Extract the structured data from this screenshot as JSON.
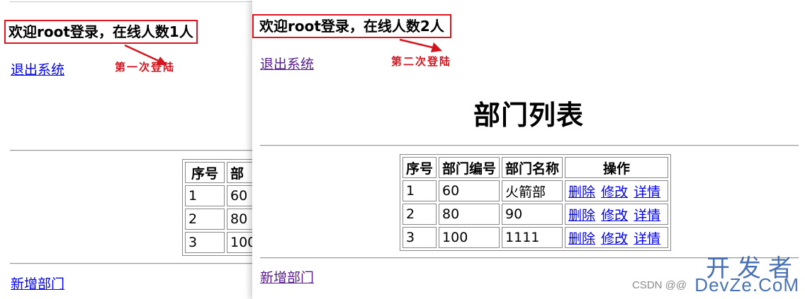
{
  "left_window": {
    "welcome": "欢迎root登录，在线人数1人",
    "logout_label": "退出系统",
    "annotation": "第一次登陆",
    "table": {
      "headers": [
        "序号",
        "部"
      ],
      "rows": [
        [
          "1",
          "60"
        ],
        [
          "2",
          "80"
        ],
        [
          "3",
          "100"
        ]
      ]
    },
    "add_label": "新增部门"
  },
  "right_window": {
    "welcome": "欢迎root登录，在线人数2人",
    "logout_label": "退出系统",
    "annotation": "第二次登陆",
    "page_title": "部门列表",
    "table": {
      "headers": [
        "序号",
        "部门编号",
        "部门名称",
        "操作"
      ],
      "rows": [
        {
          "seq": "1",
          "code": "60",
          "name": "火箭部"
        },
        {
          "seq": "2",
          "code": "80",
          "name": "90"
        },
        {
          "seq": "3",
          "code": "100",
          "name": "1111"
        }
      ],
      "actions": [
        "删除",
        "修改",
        "详情"
      ]
    },
    "add_label": "新增部门"
  },
  "watermark": {
    "cn": "开发者",
    "en": "DevZe.CoM",
    "csdn": "CSDN @@"
  },
  "colors": {
    "annotation_red": "#d4141e",
    "link_blue": "#0000ee",
    "link_visited": "#551a8b",
    "watermark_blue": "#2a5aa8"
  }
}
